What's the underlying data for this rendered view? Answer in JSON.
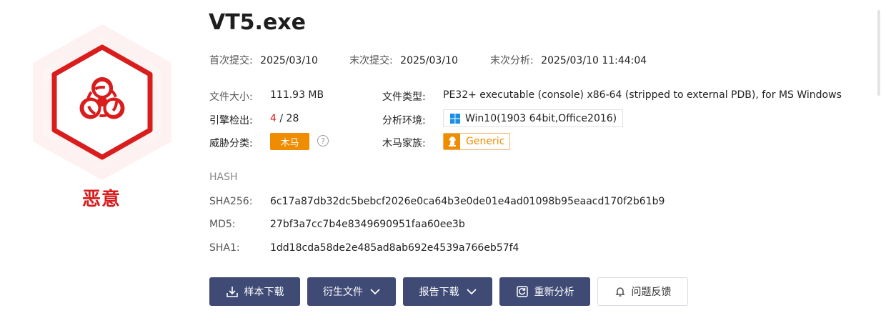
{
  "file": {
    "name": "VT5.exe",
    "verdict": "恶意"
  },
  "meta": {
    "first_submit_label": "首次提交:",
    "first_submit_value": "2025/03/10",
    "last_submit_label": "末次提交:",
    "last_submit_value": "2025/03/10",
    "last_analysis_label": "末次分析:",
    "last_analysis_value": "2025/03/10 11:44:04"
  },
  "details": {
    "size_label": "文件大小:",
    "size_value": "111.93 MB",
    "type_label": "文件类型:",
    "type_value": "PE32+ executable (console) x86-64 (stripped to external PDB), for MS Windows",
    "engine_label": "引擎检出:",
    "engine_detected": "4",
    "engine_sep": " / ",
    "engine_total": "28",
    "env_label": "分析环境:",
    "env_value": "Win10(1903 64bit,Office2016)",
    "threat_label": "威胁分类:",
    "threat_value": "木马",
    "family_label": "木马家族:",
    "family_value": "Generic"
  },
  "hash": {
    "heading": "HASH",
    "sha256_label": "SHA256:",
    "sha256_value": "6c17a87db32dc5bebcf2026e0ca64b3e0de01e4ad01098b95eaacd170f2b61b9",
    "md5_label": "MD5:",
    "md5_value": "27bf3a7cc7b4e8349690951faa60ee3b",
    "sha1_label": "SHA1:",
    "sha1_value": "1dd18cda58de2e485ad8ab692e4539a766eb57f4"
  },
  "actions": {
    "download_sample": "样本下载",
    "derived_files": "衍生文件",
    "report_download": "报告下载",
    "reanalyze": "重新分析",
    "feedback": "问题反馈"
  },
  "colors": {
    "malicious_red": "#d91c1c",
    "button_dark": "#3f4a75",
    "tag_orange": "#f08c00"
  },
  "icons": [
    "biohazard-icon",
    "help-icon",
    "windows-icon",
    "trojan-family-icon",
    "download-icon",
    "chevron-down-icon",
    "rescan-icon",
    "bell-icon"
  ]
}
